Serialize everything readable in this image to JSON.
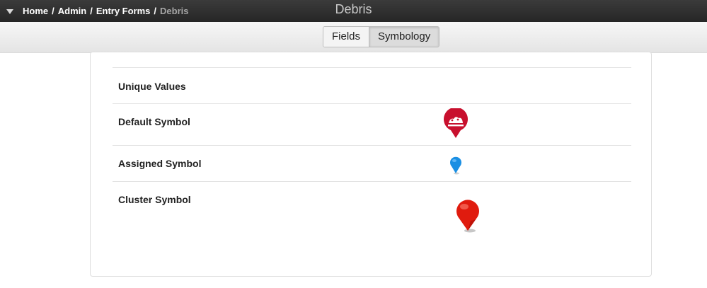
{
  "topbar": {
    "breadcrumb": [
      {
        "label": "Home"
      },
      {
        "label": "Admin"
      },
      {
        "label": "Entry Forms"
      }
    ],
    "breadcrumb_separator": "/",
    "current": "Debris",
    "title": "Debris"
  },
  "tabs": [
    {
      "label": "Fields",
      "active": false
    },
    {
      "label": "Symbology",
      "active": true
    }
  ],
  "symbology": {
    "unique_values_label": "Unique Values",
    "default_symbol_label": "Default Symbol",
    "assigned_symbol_label": "Assigned Symbol",
    "cluster_symbol_label": "Cluster Symbol"
  },
  "icons": {
    "menu": "chevron-down-icon",
    "default_symbol": "debris-marker-icon",
    "assigned_symbol": "blue-pin-icon",
    "cluster_symbol": "red-pin-icon"
  },
  "colors": {
    "topbar": "#2f2f2f",
    "default_marker": "#c8102e",
    "assigned_marker": "#1a8fe3",
    "cluster_marker": "#e01b0e"
  }
}
